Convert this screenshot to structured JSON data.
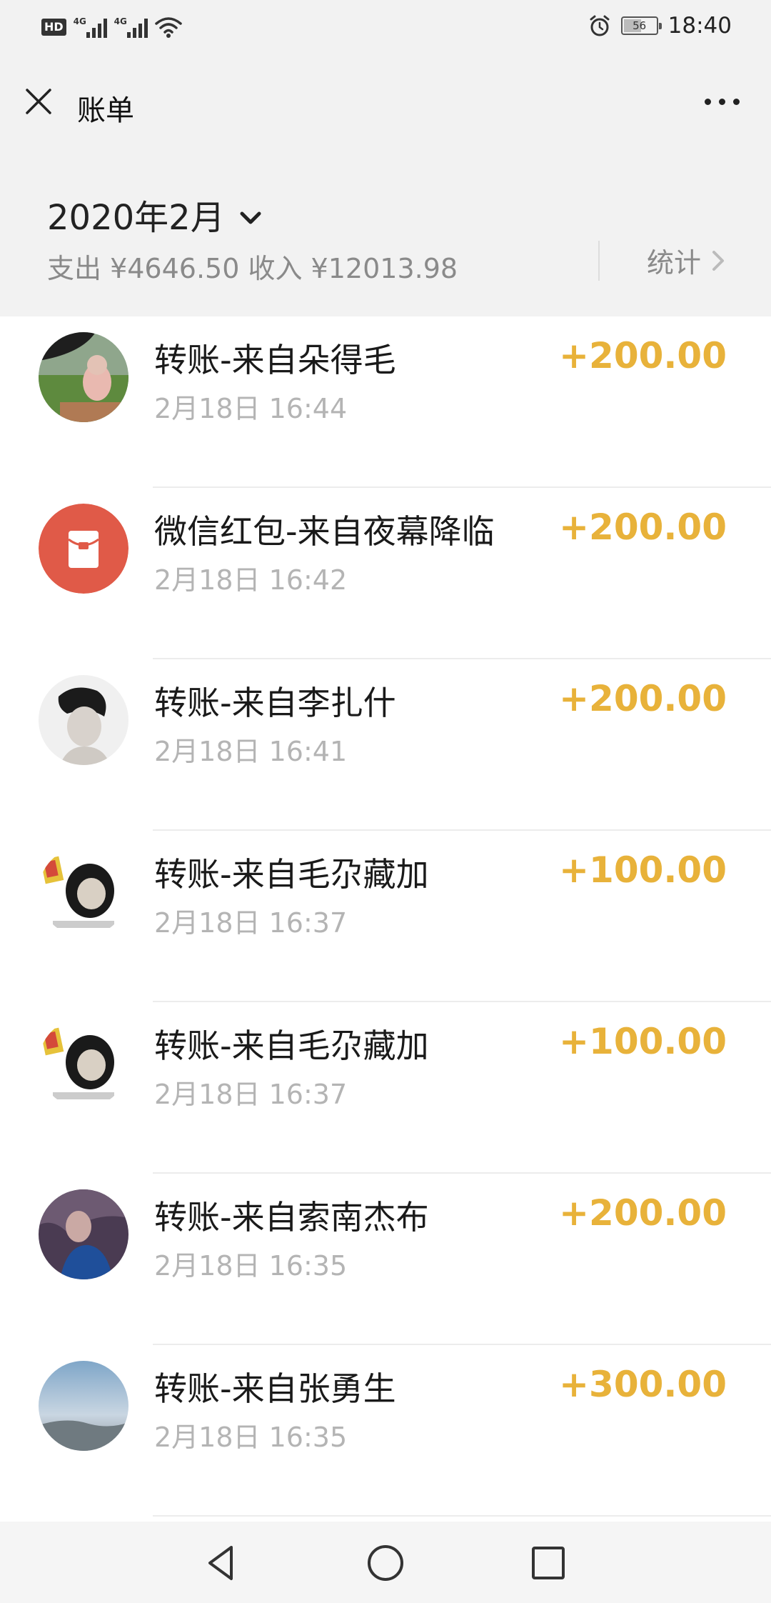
{
  "status_bar": {
    "hd": "HD",
    "sim1_net": "4G",
    "sim2_net": "4G",
    "battery": "56",
    "battery_level": 0.56,
    "time": "18:40"
  },
  "header": {
    "title": "账单"
  },
  "summary": {
    "month": "2020年2月",
    "totals": "支出 ¥4646.50 收入 ¥12013.98",
    "stats_label": "统计"
  },
  "transactions": [
    {
      "title": "转账-来自朵得毛",
      "time": "2月18日 16:44",
      "amount": "+200.00",
      "avatar": "photo-avatar"
    },
    {
      "title": "微信红包-来自夜幕降临",
      "time": "2月18日 16:42",
      "amount": "+200.00",
      "avatar": "red-packet-icon"
    },
    {
      "title": "转账-来自李扎什",
      "time": "2月18日 16:41",
      "amount": "+200.00",
      "avatar": "photo-avatar"
    },
    {
      "title": "转账-来自毛尕藏加",
      "time": "2月18日 16:37",
      "amount": "+100.00",
      "avatar": "meme-avatar"
    },
    {
      "title": "转账-来自毛尕藏加",
      "time": "2月18日 16:37",
      "amount": "+100.00",
      "avatar": "meme-avatar"
    },
    {
      "title": "转账-来自索南杰布",
      "time": "2月18日 16:35",
      "amount": "+200.00",
      "avatar": "photo-avatar"
    },
    {
      "title": "转账-来自张勇生",
      "time": "2月18日 16:35",
      "amount": "+300.00",
      "avatar": "photo-avatar"
    }
  ],
  "colors": {
    "amount": "#e8b23a",
    "red_packet": "#e05a48",
    "background": "#f2f2f2"
  }
}
